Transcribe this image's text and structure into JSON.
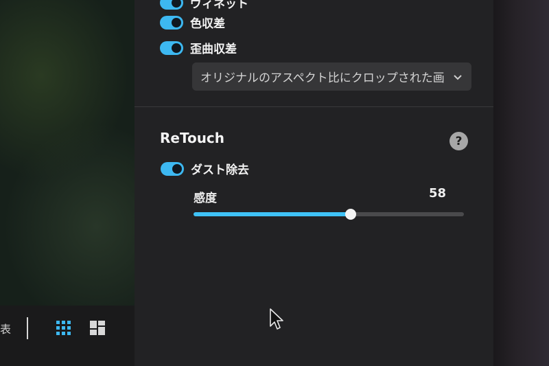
{
  "panel": {
    "lens_items": [
      {
        "label": "ヴィネット",
        "enabled": true
      },
      {
        "label": "色収差",
        "enabled": true
      },
      {
        "label": "歪曲収差",
        "enabled": true
      }
    ],
    "crop_select": {
      "value": "オリジナルのアスペクト比にクロップされた画"
    },
    "retouch": {
      "title": "ReTouch",
      "help_label": "?",
      "dust_removal": {
        "label": "ダスト除去",
        "enabled": true
      },
      "sensitivity": {
        "label": "感度",
        "value": "58",
        "fraction": 0.58
      }
    }
  },
  "bottom_bar": {
    "partial_label": "表"
  },
  "icons": {
    "grid": "grid-view-icon",
    "layout": "compare-layout-icon",
    "cursor": "mouse-cursor-icon",
    "chevron": "chevron-down-icon",
    "help": "help-icon"
  },
  "colors": {
    "accent": "#3db8f1",
    "panel_bg": "#222224"
  }
}
